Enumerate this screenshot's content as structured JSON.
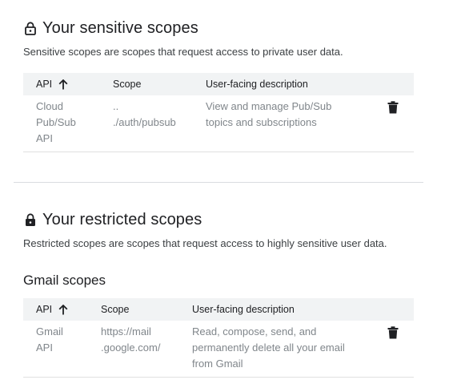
{
  "sensitive": {
    "title": "Your sensitive scopes",
    "title_icon": "lock-open-outline-icon",
    "description": "Sensitive scopes are scopes that request access to private user data.",
    "columns": {
      "api": "API",
      "scope": "Scope",
      "description": "User-facing description"
    },
    "rows": [
      {
        "api_lines": [
          "Cloud",
          "Pub/Sub",
          "API"
        ],
        "scope_lines": [
          "..",
          "./auth/pubsub"
        ],
        "description_lines": [
          "View and manage Pub/Sub",
          "topics and subscriptions"
        ],
        "action_icon": "trash-icon"
      }
    ]
  },
  "restricted": {
    "title": "Your restricted scopes",
    "title_icon": "lock-filled-icon",
    "description": "Restricted scopes are scopes that request access to highly sensitive user data.",
    "subheading": "Gmail scopes",
    "columns": {
      "api": "API",
      "scope": "Scope",
      "description": "User-facing description"
    },
    "rows": [
      {
        "api_lines": [
          "Gmail",
          "API"
        ],
        "scope_lines": [
          "https://mail",
          ".google.com/"
        ],
        "description_lines": [
          "Read, compose, send, and",
          "permanently delete all your email",
          "from Gmail"
        ],
        "action_icon": "trash-icon"
      }
    ]
  },
  "colors": {
    "text_primary": "#202124",
    "text_muted": "#80868b",
    "header_bg": "#f1f3f4",
    "divider": "#dadce0"
  }
}
